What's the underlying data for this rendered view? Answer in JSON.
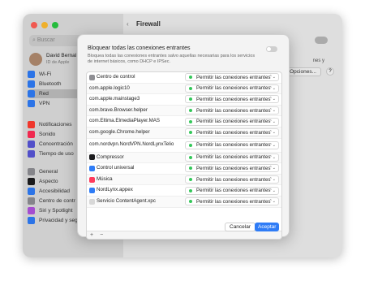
{
  "window": {
    "title": "Firewall",
    "search_placeholder": "Buscar",
    "user": {
      "name": "David Bernal",
      "sub": "ID de Apple"
    },
    "sidebar": [
      {
        "label": "Wi-Fi",
        "color": "#2f7cf6"
      },
      {
        "label": "Bluetooth",
        "color": "#2f7cf6"
      },
      {
        "label": "Red",
        "color": "#2f7cf6"
      },
      {
        "label": "VPN",
        "color": "#2f7cf6"
      },
      {
        "label": "Notificaciones",
        "color": "#ff3b30"
      },
      {
        "label": "Sonido",
        "color": "#ff2d55"
      },
      {
        "label": "Concentración",
        "color": "#5856d6"
      },
      {
        "label": "Tiempo de uso",
        "color": "#5856d6"
      },
      {
        "label": "General",
        "color": "#8e8e93"
      },
      {
        "label": "Aspecto",
        "color": "#1c1c1e"
      },
      {
        "label": "Accesibilidad",
        "color": "#2f7cf6"
      },
      {
        "label": "Centro de contr",
        "color": "#8e8e93"
      },
      {
        "label": "Siri y Spotlight",
        "color": "#af52de"
      },
      {
        "label": "Privacidad y segu",
        "color": "#2f7cf6"
      }
    ],
    "options_label": "Opciones...",
    "help_label": "?",
    "side_text": "nes y"
  },
  "modal": {
    "block_title": "Bloquear todas las conexiones entrantes",
    "block_desc": "Bloquea todas las conexiones entrantes salvo aquellas necesarias para los servicios de internet básicos, como DHCP e IPSec.",
    "permission_label": "Permitir las conexiones entrantes",
    "apps": [
      {
        "name": "Centro de control",
        "icon": "control-center-icon",
        "color": "#8e8e93"
      },
      {
        "name": "com.apple.logic10",
        "icon": "",
        "color": ""
      },
      {
        "name": "com.apple.mainstage3",
        "icon": "",
        "color": ""
      },
      {
        "name": "com.brave.Browser.helper",
        "icon": "",
        "color": ""
      },
      {
        "name": "com.Eltima.ElmediaPlayer.MAS",
        "icon": "",
        "color": ""
      },
      {
        "name": "com.google.Chrome.helper",
        "icon": "",
        "color": ""
      },
      {
        "name": "com.nordvpn.NordVPN.NordLynxTelio",
        "icon": "",
        "color": "",
        "tall": true
      },
      {
        "name": "Compressor",
        "icon": "compressor-icon",
        "color": "#1c1c1e"
      },
      {
        "name": "Control universal",
        "icon": "universal-control-icon",
        "color": "#2f7cf6"
      },
      {
        "name": "Música",
        "icon": "music-icon",
        "color": "#ff3b5c"
      },
      {
        "name": "NordLynx.appex",
        "icon": "nordlynx-icon",
        "color": "#2f7cf6"
      },
      {
        "name": "Servicio ContentAgent.xpc",
        "icon": "contentagent-icon",
        "color": "#d8d8d8"
      }
    ],
    "add_label": "+",
    "remove_label": "−",
    "cancel_label": "Cancelar",
    "accept_label": "Aceptar"
  }
}
